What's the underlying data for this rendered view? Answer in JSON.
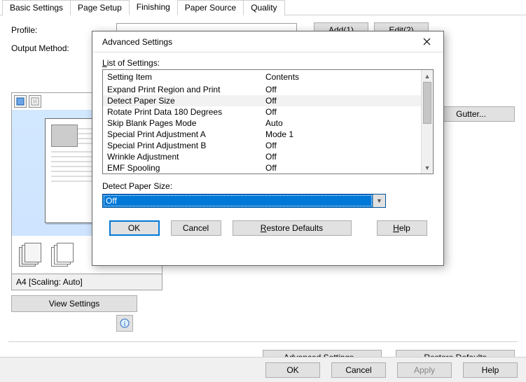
{
  "tabs": [
    "Basic Settings",
    "Page Setup",
    "Finishing",
    "Paper Source",
    "Quality"
  ],
  "activeTab": 2,
  "labels": {
    "profile": "Profile:",
    "outputMethod": "Output Method:"
  },
  "profileButtons": {
    "add": "Add(1)",
    "edit": "Edit(2)"
  },
  "gutterButton": "Gutter...",
  "thumbnailStatus": "A4 [Scaling: Auto]",
  "viewSettingsButton": "View Settings",
  "mainLowerButtons": {
    "advanced": "Advanced Settings...",
    "restore": "Restore Defaults"
  },
  "bottomBar": {
    "ok": "OK",
    "cancel": "Cancel",
    "apply": "Apply",
    "help": "Help"
  },
  "dialog": {
    "title": "Advanced Settings",
    "listLabel": "List of Settings:",
    "columns": {
      "item": "Setting Item",
      "contents": "Contents"
    },
    "rows": [
      {
        "item": "Expand Print Region and Print",
        "contents": "Off"
      },
      {
        "item": "Detect Paper Size",
        "contents": "Off"
      },
      {
        "item": "Rotate Print Data 180 Degrees",
        "contents": "Off"
      },
      {
        "item": "Skip Blank Pages Mode",
        "contents": "Auto"
      },
      {
        "item": "Special Print Adjustment A",
        "contents": "Mode 1"
      },
      {
        "item": "Special Print Adjustment B",
        "contents": "Off"
      },
      {
        "item": "Wrinkle Adjustment",
        "contents": "Off"
      },
      {
        "item": "EMF Spooling",
        "contents": "Off"
      }
    ],
    "selectedRowIndex": 1,
    "fieldLabel": "Detect Paper Size:",
    "fieldValue": "Off",
    "buttons": {
      "ok": "OK",
      "cancel": "Cancel",
      "restore": "Restore Defaults",
      "help": "Help"
    }
  }
}
